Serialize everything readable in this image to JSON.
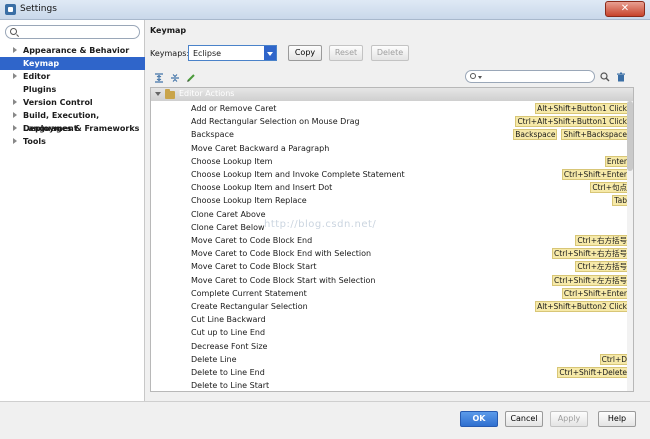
{
  "window": {
    "title": "Settings"
  },
  "sidebar": {
    "search_placeholder": "",
    "items": [
      {
        "label": "Appearance & Behavior",
        "expandable": true,
        "selected": false
      },
      {
        "label": "Keymap",
        "expandable": false,
        "selected": true
      },
      {
        "label": "Editor",
        "expandable": true,
        "selected": false
      },
      {
        "label": "Plugins",
        "expandable": false,
        "selected": false
      },
      {
        "label": "Version Control",
        "expandable": true,
        "selected": false
      },
      {
        "label": "Build, Execution, Deployment",
        "expandable": true,
        "selected": false
      },
      {
        "label": "Languages & Frameworks",
        "expandable": true,
        "selected": false
      },
      {
        "label": "Tools",
        "expandable": true,
        "selected": false
      }
    ]
  },
  "main": {
    "title": "Keymap",
    "keymaps_label": "Keymaps:",
    "keymap_value": "Eclipse",
    "copy_label": "Copy",
    "reset_label": "Reset",
    "delete_label": "Delete",
    "filter_placeholder": ""
  },
  "actions": {
    "group_label": "Editor Actions",
    "rows": [
      {
        "name": "Add or Remove Caret",
        "shortcuts": [
          "Alt+Shift+Button1 Click"
        ]
      },
      {
        "name": "Add Rectangular Selection on Mouse Drag",
        "shortcuts": [
          "Ctrl+Alt+Shift+Button1 Click"
        ]
      },
      {
        "name": "Backspace",
        "shortcuts": [
          "Backspace",
          "Shift+Backspace"
        ]
      },
      {
        "name": "Move Caret Backward a Paragraph",
        "shortcuts": []
      },
      {
        "name": "Choose Lookup Item",
        "shortcuts": [
          "Enter"
        ]
      },
      {
        "name": "Choose Lookup Item and Invoke Complete Statement",
        "shortcuts": [
          "Ctrl+Shift+Enter"
        ]
      },
      {
        "name": "Choose Lookup Item and Insert Dot",
        "shortcuts": [
          "Ctrl+句点"
        ]
      },
      {
        "name": "Choose Lookup Item Replace",
        "shortcuts": [
          "Tab"
        ]
      },
      {
        "name": "Clone Caret Above",
        "shortcuts": []
      },
      {
        "name": "Clone Caret Below",
        "shortcuts": []
      },
      {
        "name": "Move Caret to Code Block End",
        "shortcuts": [
          "Ctrl+右方括号"
        ]
      },
      {
        "name": "Move Caret to Code Block End with Selection",
        "shortcuts": [
          "Ctrl+Shift+右方括号"
        ]
      },
      {
        "name": "Move Caret to Code Block Start",
        "shortcuts": [
          "Ctrl+左方括号"
        ]
      },
      {
        "name": "Move Caret to Code Block Start with Selection",
        "shortcuts": [
          "Ctrl+Shift+左方括号"
        ]
      },
      {
        "name": "Complete Current Statement",
        "shortcuts": [
          "Ctrl+Shift+Enter"
        ]
      },
      {
        "name": "Create Rectangular Selection",
        "shortcuts": [
          "Alt+Shift+Button2 Click"
        ]
      },
      {
        "name": "Cut Line Backward",
        "shortcuts": []
      },
      {
        "name": "Cut up to Line End",
        "shortcuts": []
      },
      {
        "name": "Decrease Font Size",
        "shortcuts": []
      },
      {
        "name": "Delete Line",
        "shortcuts": [
          "Ctrl+D"
        ]
      },
      {
        "name": "Delete to Line End",
        "shortcuts": [
          "Ctrl+Shift+Delete"
        ]
      },
      {
        "name": "Delete to Line Start",
        "shortcuts": []
      }
    ]
  },
  "watermark": "http://blog.csdn.net/",
  "footer": {
    "ok_label": "OK",
    "cancel_label": "Cancel",
    "apply_label": "Apply",
    "help_label": "Help"
  },
  "colors": {
    "selection": "#2f65ca",
    "shortcut_bg": "#f6e9a8",
    "ok_button": "#2f6fcf"
  }
}
